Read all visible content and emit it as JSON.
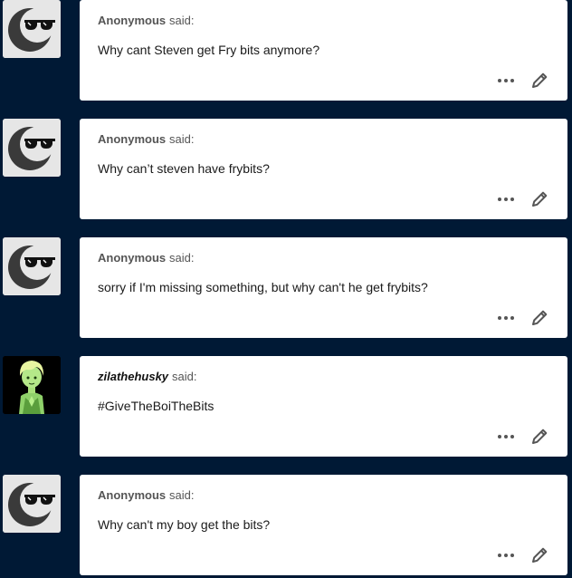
{
  "said_label": "said:",
  "asks": [
    {
      "asker": "Anonymous",
      "question": "Why cant Steven get Fry bits anymore?",
      "avatar": "sunglasses-moon"
    },
    {
      "asker": "Anonymous",
      "question": "Why can’t steven have frybits?",
      "avatar": "sunglasses-moon"
    },
    {
      "asker": "Anonymous",
      "question": "sorry if I'm missing something, but why can't he get frybits?",
      "avatar": "sunglasses-moon"
    },
    {
      "asker": "zilathehusky",
      "question": "#GiveTheBoiTheBits",
      "avatar": "green-character"
    },
    {
      "asker": "Anonymous",
      "question": "Why can't my boy get the bits?",
      "avatar": "sunglasses-moon"
    }
  ],
  "icons": {
    "more": "more-options-icon",
    "edit": "pencil-edit-icon"
  },
  "colors": {
    "background": "#001935",
    "card": "#ffffff"
  }
}
